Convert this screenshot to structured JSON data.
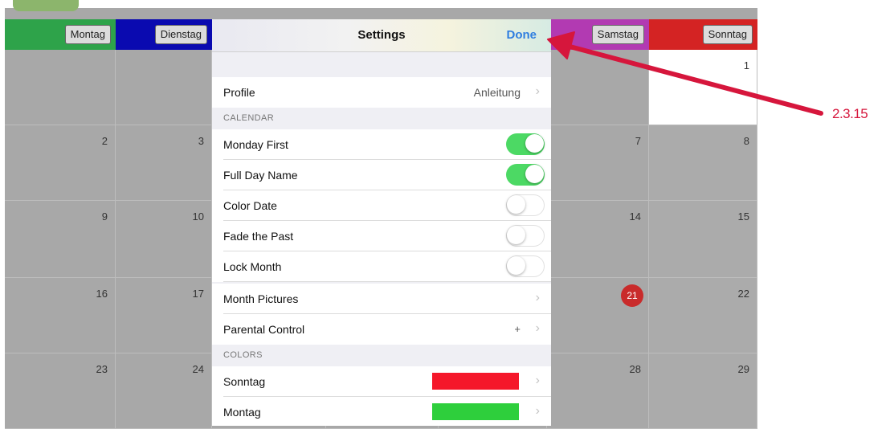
{
  "calendar": {
    "weekdays": [
      {
        "label": "Montag",
        "color": "#2ea34a"
      },
      {
        "label": "Dienstag",
        "color": "#0a0ab0"
      },
      {
        "label": "",
        "color": "#a8a8a8"
      },
      {
        "label": "",
        "color": "#a8a8a8"
      },
      {
        "label": "",
        "color": "#a8a8a8"
      },
      {
        "label": "Samstag",
        "color": "#b23ab2"
      },
      {
        "label": "Sonntag",
        "color": "#d42323"
      }
    ],
    "weeks": [
      [
        "",
        "",
        "",
        "",
        "",
        "",
        "1"
      ],
      [
        "2",
        "3",
        "",
        "",
        "",
        "7",
        "8"
      ],
      [
        "9",
        "10",
        "",
        "",
        "",
        "14",
        "15"
      ],
      [
        "16",
        "17",
        "",
        "",
        "",
        "21",
        "22"
      ],
      [
        "23",
        "24",
        "",
        "",
        "",
        "28",
        "29"
      ]
    ],
    "today": "21",
    "today_color": "#c92b2b"
  },
  "settings": {
    "title": "Settings",
    "done_label": "Done",
    "profile": {
      "label": "Profile",
      "value": "Anleitung"
    },
    "calendar_header": "CALENDAR",
    "toggles": [
      {
        "label": "Monday First",
        "on": true
      },
      {
        "label": "Full Day Name",
        "on": true
      },
      {
        "label": "Color Date",
        "on": false
      },
      {
        "label": "Fade the Past",
        "on": false
      },
      {
        "label": "Lock Month",
        "on": false
      }
    ],
    "month_pictures": {
      "label": "Month Pictures"
    },
    "parental_control": {
      "label": "Parental Control",
      "value": "+"
    },
    "colors_header": "COLORS",
    "colors": [
      {
        "label": "Sonntag",
        "color": "#f5172a"
      },
      {
        "label": "Montag",
        "color": "#2ecf3c"
      }
    ],
    "chevron": "›",
    "toggle_on_color": "#4cd964"
  },
  "annotation": {
    "label": "2.3.15",
    "color": "#d6163c"
  }
}
